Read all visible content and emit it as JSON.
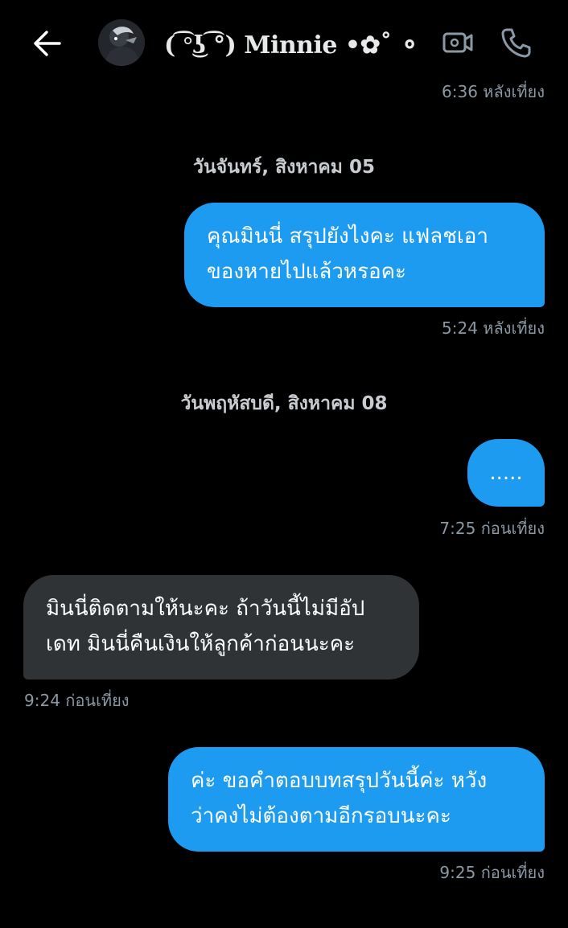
{
  "header": {
    "contact_name": "( ͡°͜ʖ ͡°) Minnie •✿˚ ⚬ ∂ ...",
    "back_icon": "back-arrow-icon",
    "video_icon": "video-call-icon",
    "phone_icon": "phone-call-icon"
  },
  "colors": {
    "background": "#000000",
    "outgoing_bubble": "#1d9bf0",
    "incoming_bubble": "#2f3336",
    "timestamp": "#8b98a5"
  },
  "messages": [
    {
      "type": "timestamp",
      "side": "right",
      "text": "6:36 หลังเที่ยง"
    },
    {
      "type": "date",
      "text": "วันจันทร์, สิงหาคม 05"
    },
    {
      "type": "message",
      "side": "out",
      "text": "คุณมินนี่ สรุปยังไงคะ แฟลชเอา\nของหายไปแล้วหรอคะ",
      "time": "5:24 หลังเที่ยง"
    },
    {
      "type": "date",
      "text": "วันพฤหัสบดี, สิงหาคม 08"
    },
    {
      "type": "message",
      "side": "out",
      "text": ".....",
      "time": "7:25 ก่อนเที่ยง"
    },
    {
      "type": "message",
      "side": "in",
      "text": "มินนี่ติดตามให้นะคะ ถ้าวันนี้ไม่มีอัป\nเดท มินนี่คืนเงินให้ลูกค้าก่อนนะคะ",
      "time": "9:24 ก่อนเที่ยง"
    },
    {
      "type": "message",
      "side": "out",
      "text": "ค่ะ ขอคำตอบบทสรุปวันนี้ค่ะ หวัง\nว่าคงไม่ต้องตามอีกรอบนะคะ",
      "time": "9:25 ก่อนเที่ยง"
    }
  ]
}
